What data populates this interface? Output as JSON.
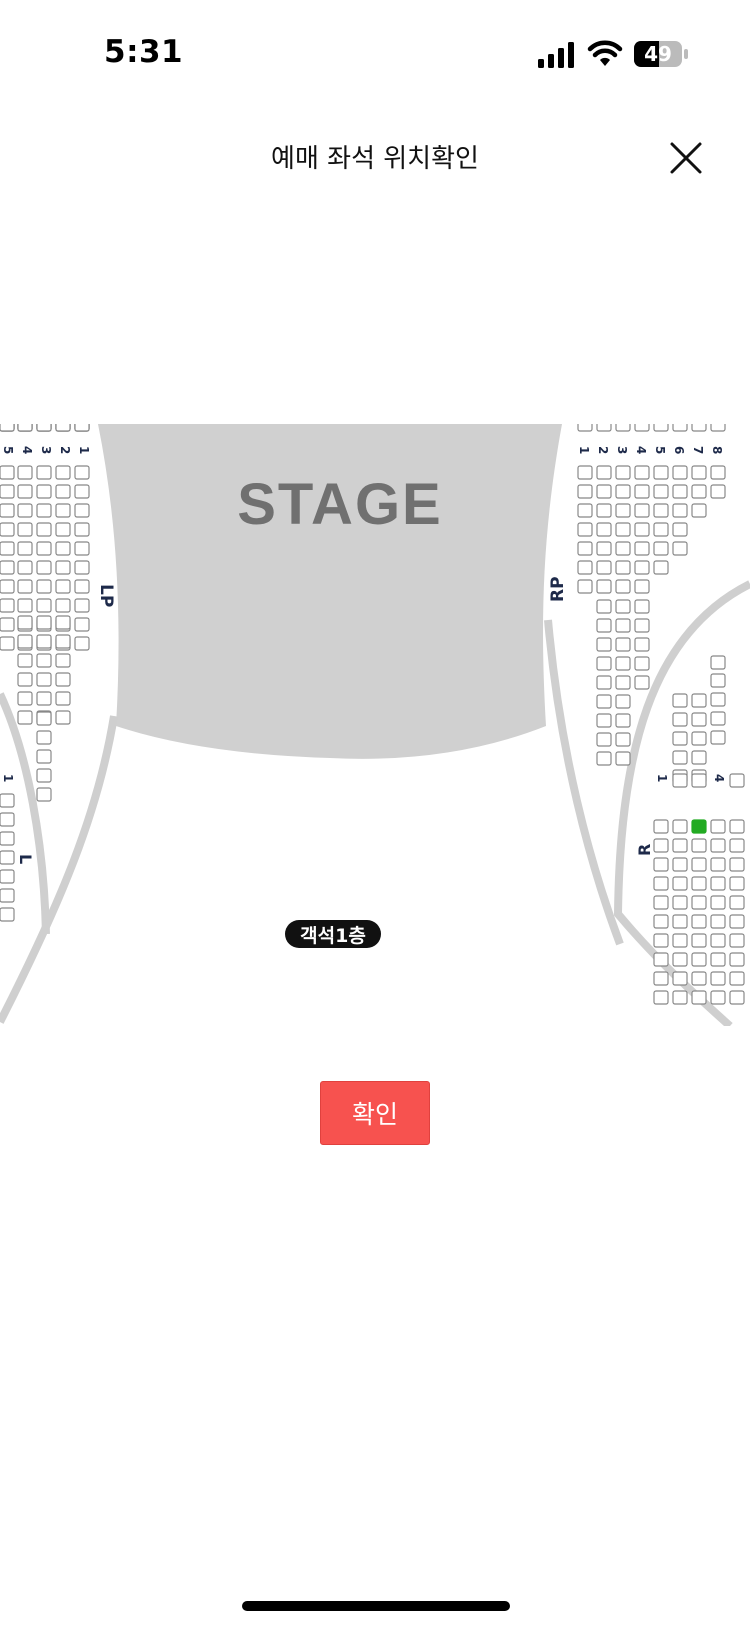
{
  "status_bar": {
    "time": "5:31",
    "battery": "49"
  },
  "header": {
    "title": "예매 좌석 위치확인"
  },
  "seat_map": {
    "stage_label": "STAGE",
    "floor_badge": "객석1층",
    "sections": {
      "lp": "LP",
      "rp": "RP",
      "l": "L",
      "r": "R"
    },
    "colors": {
      "stage": "#d0d0d0",
      "seat_outline": "#888888",
      "selected_seat": "#22aa22",
      "curve": "#cfcfcf",
      "label": "#1e2a4a"
    }
  },
  "confirm_button": {
    "label": "확인"
  }
}
